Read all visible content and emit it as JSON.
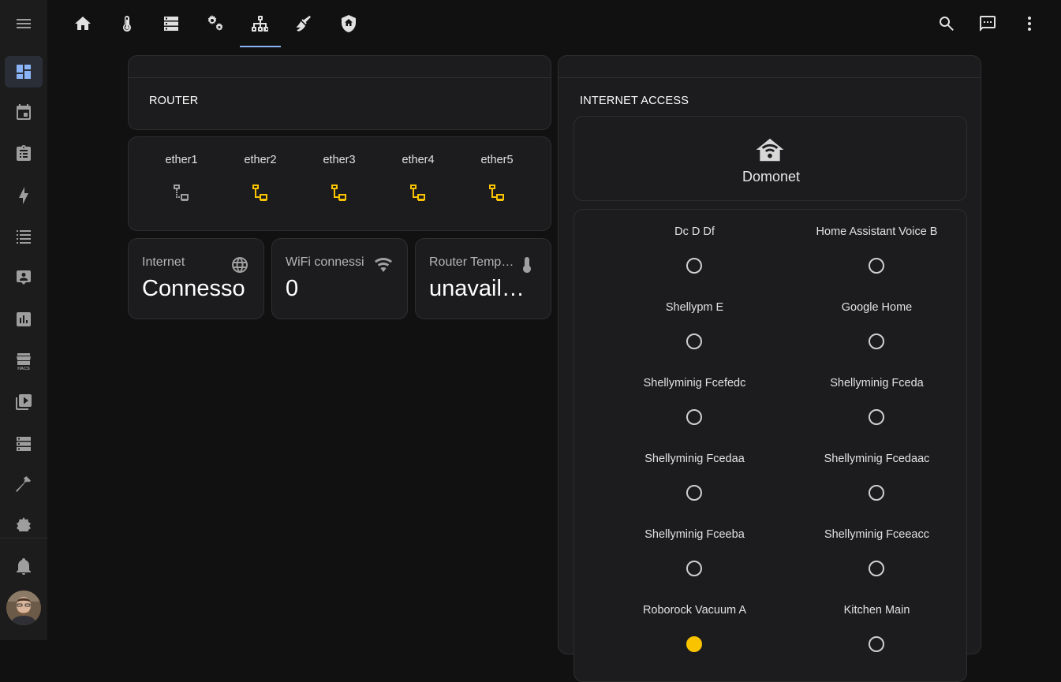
{
  "sidebar": {
    "items": [
      {
        "icon": "menu-icon"
      },
      {
        "icon": "dashboard-icon",
        "active": true
      },
      {
        "icon": "calendar-icon"
      },
      {
        "icon": "todo-clipboard-icon"
      },
      {
        "icon": "energy-lightning-icon"
      },
      {
        "icon": "logbook-list-icon"
      },
      {
        "icon": "person-card-icon"
      },
      {
        "icon": "history-chart-icon"
      },
      {
        "icon": "hacs-store-icon",
        "label": "HACS"
      },
      {
        "icon": "media-play-icon"
      },
      {
        "icon": "server-icon"
      },
      {
        "icon": "developer-hammer-icon"
      },
      {
        "icon": "settings-cog-icon"
      },
      {
        "icon": "notifications-bell-icon"
      }
    ]
  },
  "tabs": [
    {
      "icon": "home-icon"
    },
    {
      "icon": "thermometer-icon"
    },
    {
      "icon": "server-icon"
    },
    {
      "icon": "cogs-icon"
    },
    {
      "icon": "network-lan-icon",
      "active": true
    },
    {
      "icon": "broom-icon"
    },
    {
      "icon": "shield-home-icon"
    }
  ],
  "top_actions": [
    {
      "icon": "search-icon"
    },
    {
      "icon": "assist-chat-icon"
    },
    {
      "icon": "more-vertical-icon"
    }
  ],
  "router": {
    "title": "ROUTER",
    "ports": [
      {
        "label": "ether1",
        "connected": false
      },
      {
        "label": "ether2",
        "connected": true
      },
      {
        "label": "ether3",
        "connected": true
      },
      {
        "label": "ether4",
        "connected": true
      },
      {
        "label": "ether5",
        "connected": true
      }
    ]
  },
  "tiles": [
    {
      "name": "Internet",
      "value": "Connesso",
      "icon": "web-globe-icon"
    },
    {
      "name": "WiFi connessi",
      "value": "0",
      "icon": "wifi-icon"
    },
    {
      "name": "Router Temperatura",
      "value": "unavailable",
      "icon": "thermometer-icon"
    }
  ],
  "internet": {
    "title": "INTERNET ACCESS",
    "network_name": "Domonet",
    "network_icon": "home-wifi-icon",
    "devices": [
      {
        "name": "Dc D Df",
        "on": false
      },
      {
        "name": "Home Assistant Voice B",
        "on": false
      },
      {
        "name": "Shellypm E",
        "on": false
      },
      {
        "name": "Google Home",
        "on": false
      },
      {
        "name": "Shellyminig Fcefedc",
        "on": false
      },
      {
        "name": "Shellyminig Fceda",
        "on": false
      },
      {
        "name": "Shellyminig Fcedaa",
        "on": false
      },
      {
        "name": "Shellyminig Fcedaac",
        "on": false
      },
      {
        "name": "Shellyminig Fceeba",
        "on": false
      },
      {
        "name": "Shellyminig Fceeacc",
        "on": false
      },
      {
        "name": "Roborock Vacuum A",
        "on": true
      },
      {
        "name": "Kitchen Main",
        "on": false
      }
    ]
  },
  "colors": {
    "accent": "#8ab4f8",
    "active_port": "#f9c300",
    "inactive_port": "#9e9e9e",
    "card_bg": "#1c1c1e",
    "page_bg": "#111111"
  }
}
